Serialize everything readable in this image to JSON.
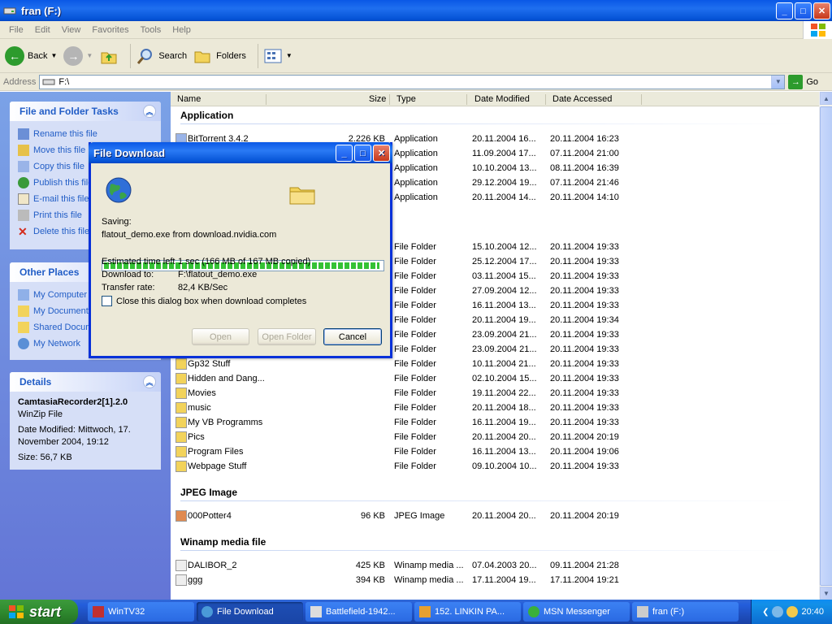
{
  "window": {
    "title": "fran (F:)",
    "min": "_",
    "max": "□",
    "close": "✕"
  },
  "menu": [
    "File",
    "Edit",
    "View",
    "Favorites",
    "Tools",
    "Help"
  ],
  "toolbar": {
    "back": "Back",
    "search": "Search",
    "folders": "Folders"
  },
  "address": {
    "label": "Address",
    "value": "F:\\",
    "go": "Go"
  },
  "tasks_panel": {
    "title": "File and Folder Tasks",
    "items": [
      "Rename this file",
      "Move this file",
      "Copy this file",
      "Publish this file",
      "E-mail this file",
      "Print this file",
      "Delete this file"
    ]
  },
  "places_panel": {
    "title": "Other Places",
    "items": [
      "My Computer",
      "My Documents",
      "Shared Documents",
      "My Network"
    ]
  },
  "details_panel": {
    "title": "Details",
    "name": "CamtasiaRecorder2[1].2.0",
    "type": "WinZip File",
    "modified_line1": "Date Modified: Mittwoch, 17.",
    "modified_line2": "November 2004, 19:12",
    "size": "Size: 56,7 KB"
  },
  "columns": {
    "name": "Name",
    "size": "Size",
    "type": "Type",
    "date_modified": "Date Modified",
    "date_accessed": "Date Accessed"
  },
  "groups": {
    "application": "Application",
    "jpeg": "JPEG Image",
    "winamp": "Winamp media file"
  },
  "app_rows": [
    {
      "name": "BitTorrent 3.4.2",
      "size": "2.226 KB",
      "type": "Application",
      "modified": "20.11.2004 16...",
      "accessed": "20.11.2004 16:23"
    },
    {
      "name": "",
      "size": "",
      "type": "Application",
      "modified": "11.09.2004 17...",
      "accessed": "07.11.2004 21:00"
    },
    {
      "name": "",
      "size": "",
      "type": "Application",
      "modified": "10.10.2004 13...",
      "accessed": "08.11.2004 16:39"
    },
    {
      "name": "",
      "size": "",
      "type": "Application",
      "modified": "29.12.2004 19...",
      "accessed": "07.11.2004 21:46"
    },
    {
      "name": "",
      "size": "",
      "type": "Application",
      "modified": "20.11.2004 14...",
      "accessed": "20.11.2004 14:10"
    }
  ],
  "folder_rows": [
    {
      "name": "",
      "type": "File Folder",
      "modified": "15.10.2004 12...",
      "accessed": "20.11.2004 19:33"
    },
    {
      "name": "",
      "type": "File Folder",
      "modified": "25.12.2004 17...",
      "accessed": "20.11.2004 19:33"
    },
    {
      "name": "",
      "type": "File Folder",
      "modified": "03.11.2004 15...",
      "accessed": "20.11.2004 19:33"
    },
    {
      "name": "",
      "type": "File Folder",
      "modified": "27.09.2004 12...",
      "accessed": "20.11.2004 19:33"
    },
    {
      "name": "",
      "type": "File Folder",
      "modified": "16.11.2004 13...",
      "accessed": "20.11.2004 19:33"
    },
    {
      "name": "",
      "type": "File Folder",
      "modified": "20.11.2004 19...",
      "accessed": "20.11.2004 19:34"
    },
    {
      "name": "",
      "type": "File Folder",
      "modified": "23.09.2004 21...",
      "accessed": "20.11.2004 19:33"
    },
    {
      "name": "",
      "type": "File Folder",
      "modified": "23.09.2004 21...",
      "accessed": "20.11.2004 19:33"
    },
    {
      "name": "Gp32 Stuff",
      "type": "File Folder",
      "modified": "10.11.2004 21...",
      "accessed": "20.11.2004 19:33"
    },
    {
      "name": "Hidden and Dang...",
      "type": "File Folder",
      "modified": "02.10.2004 15...",
      "accessed": "20.11.2004 19:33"
    },
    {
      "name": "Movies",
      "type": "File Folder",
      "modified": "19.11.2004 22...",
      "accessed": "20.11.2004 19:33"
    },
    {
      "name": "music",
      "type": "File Folder",
      "modified": "20.11.2004 18...",
      "accessed": "20.11.2004 19:33"
    },
    {
      "name": "My VB Programms",
      "type": "File Folder",
      "modified": "16.11.2004 19...",
      "accessed": "20.11.2004 19:33"
    },
    {
      "name": "Pics",
      "type": "File Folder",
      "modified": "20.11.2004 20...",
      "accessed": "20.11.2004 20:19"
    },
    {
      "name": "Program Files",
      "type": "File Folder",
      "modified": "16.11.2004 13...",
      "accessed": "20.11.2004 19:06"
    },
    {
      "name": "Webpage Stuff",
      "type": "File Folder",
      "modified": "09.10.2004 10...",
      "accessed": "20.11.2004 19:33"
    }
  ],
  "jpeg_rows": [
    {
      "name": "000Potter4",
      "size": "96 KB",
      "type": "JPEG Image",
      "modified": "20.11.2004 20...",
      "accessed": "20.11.2004 20:19"
    }
  ],
  "winamp_rows": [
    {
      "name": "DALIBOR_2",
      "size": "425 KB",
      "type": "Winamp media ...",
      "modified": "07.04.2003 20...",
      "accessed": "09.11.2004 21:28"
    },
    {
      "name": "ggg",
      "size": "394 KB",
      "type": "Winamp media ...",
      "modified": "17.11.2004 19...",
      "accessed": "17.11.2004 19:21"
    }
  ],
  "dialog": {
    "title": "File Download",
    "saving_label": "Saving:",
    "saving_value": "flatout_demo.exe from download.nvidia.com",
    "progress": 0.99,
    "eta_label": "Estimated time left",
    "eta_value": "1 sec (166 MB of 167 MB copied)",
    "dest_label": "Download to:",
    "dest_value": "F:\\flatout_demo.exe",
    "rate_label": "Transfer rate:",
    "rate_value": "82,4 KB/Sec",
    "checkbox_label": "Close this dialog box when download completes",
    "btn_open": "Open",
    "btn_open_folder": "Open Folder",
    "btn_cancel": "Cancel"
  },
  "taskbar": {
    "start": "start",
    "tasks": [
      "WinTV32",
      "File Download",
      "Battlefield-1942...",
      "152. LINKIN PA...",
      "MSN Messenger",
      "fran (F:)"
    ],
    "clock": "20:40"
  }
}
